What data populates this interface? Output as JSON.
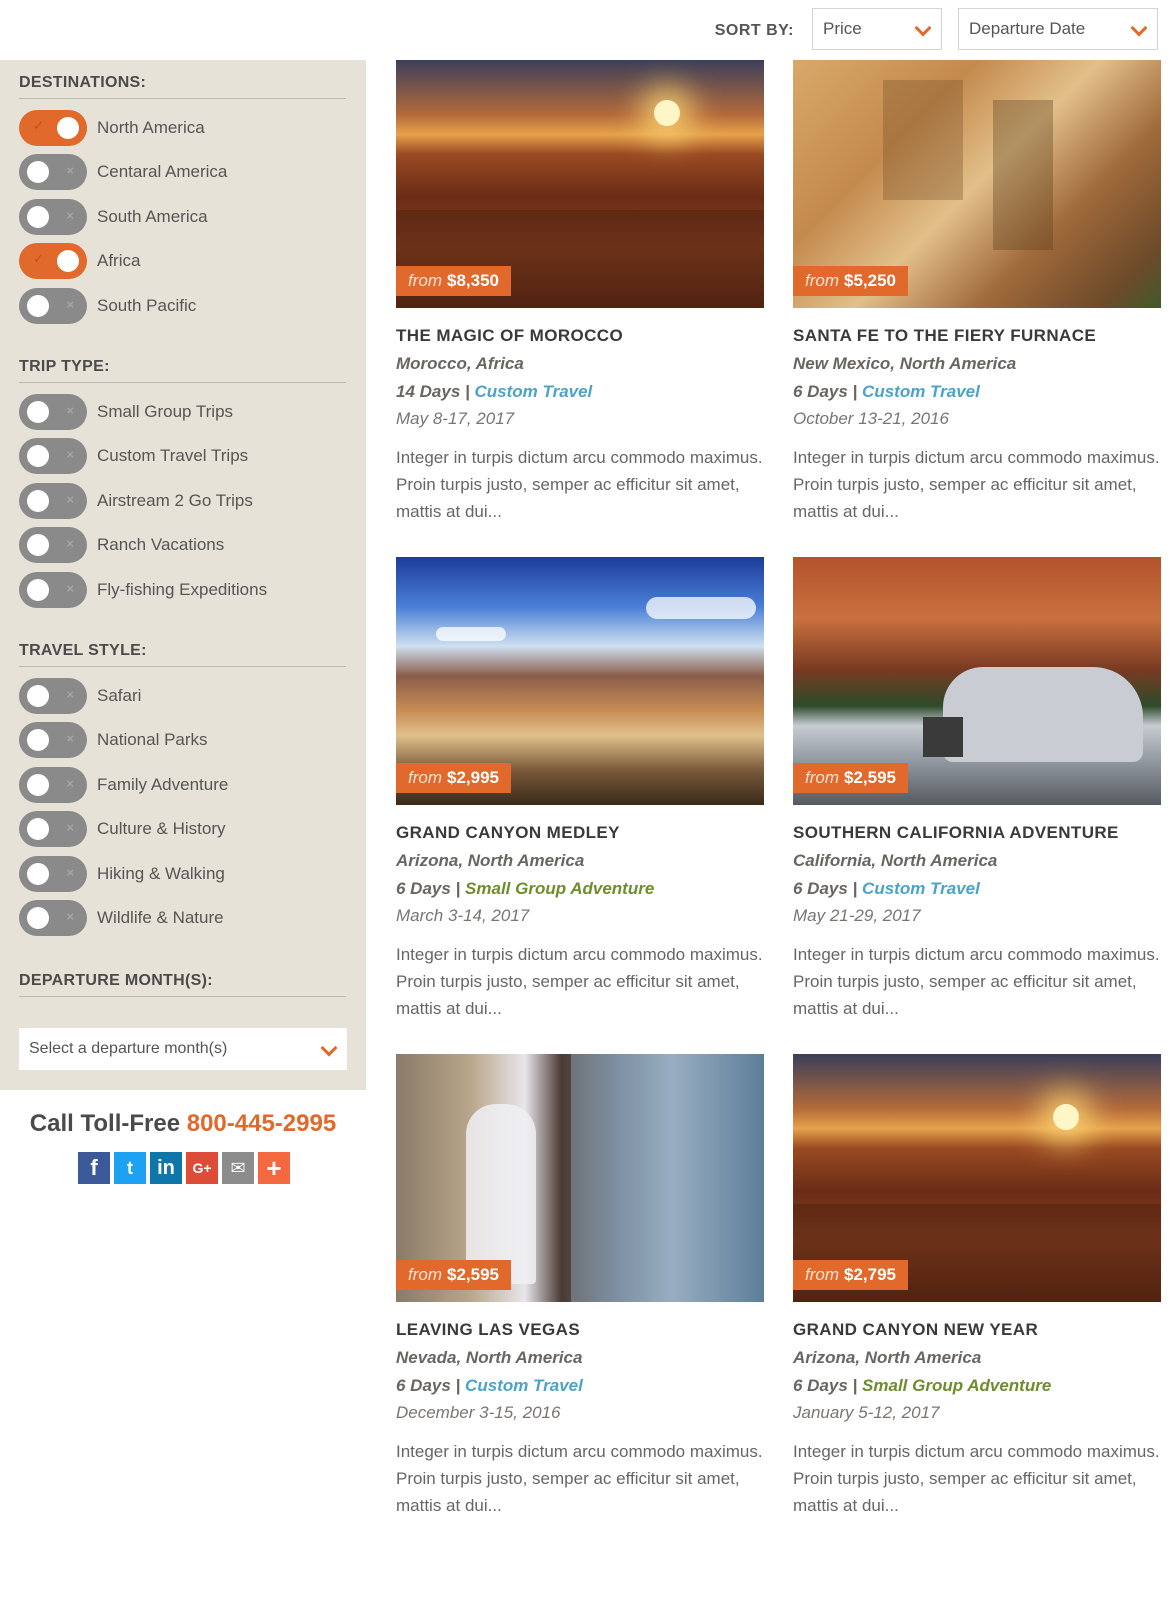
{
  "sort": {
    "label": "SORT BY:",
    "price_value": "Price",
    "date_value": "Departure Date"
  },
  "filters": {
    "destinations": {
      "heading": "DESTINATIONS:",
      "items": [
        {
          "label": "North America",
          "checked": true
        },
        {
          "label": "Centaral America",
          "checked": false
        },
        {
          "label": "South America",
          "checked": false
        },
        {
          "label": "Africa",
          "checked": true
        },
        {
          "label": "South Pacific",
          "checked": false
        }
      ]
    },
    "trip_type": {
      "heading": "TRIP TYPE:",
      "items": [
        {
          "label": "Small Group Trips",
          "checked": false
        },
        {
          "label": "Custom Travel Trips",
          "checked": false
        },
        {
          "label": "Airstream 2 Go Trips",
          "checked": false
        },
        {
          "label": "Ranch Vacations",
          "checked": false
        },
        {
          "label": "Fly-fishing Expeditions",
          "checked": false
        }
      ]
    },
    "travel_style": {
      "heading": "TRAVEL STYLE:",
      "items": [
        {
          "label": "Safari",
          "checked": false
        },
        {
          "label": "National Parks",
          "checked": false
        },
        {
          "label": "Family Adventure",
          "checked": false
        },
        {
          "label": "Culture & History",
          "checked": false
        },
        {
          "label": "Hiking & Walking",
          "checked": false
        },
        {
          "label": "Wildlife & Nature",
          "checked": false
        }
      ]
    },
    "departure": {
      "heading": "DEPARTURE MONTH(S):",
      "placeholder": "Select a departure month(s)"
    }
  },
  "contact": {
    "call_label": "Call Toll-Free",
    "phone": "800-445-2995"
  },
  "social": {
    "facebook": "f",
    "twitter": "t",
    "linkedin": "in",
    "google": "G+",
    "email": "✉",
    "share": "+"
  },
  "toggle_marks": {
    "on": "✓",
    "off": "×"
  },
  "price_from": "from",
  "trips": [
    {
      "price": "$8,350",
      "title": "THE MAGIC OF MOROCCO",
      "location": "Morocco, Africa",
      "days": "14 Days |",
      "type": "Custom Travel",
      "dates": "May 8-17, 2017",
      "description": "Integer in turpis dictum arcu commodo maximus. Proin turpis justo, semper ac efficitur sit amet, mattis at dui..."
    },
    {
      "price": "$5,250",
      "title": "SANTA FE TO THE FIERY FURNACE",
      "location": "New Mexico, North America",
      "days": "6 Days |",
      "type": "Custom Travel",
      "dates": "October 13-21, 2016",
      "description": "Integer in turpis dictum arcu commodo maximus. Proin turpis justo, semper ac efficitur sit amet, mattis at dui..."
    },
    {
      "price": "$2,995",
      "title": "GRAND CANYON MEDLEY",
      "location": "Arizona, North America",
      "days": "6 Days |",
      "type": "Small Group Adventure",
      "dates": "March 3-14, 2017",
      "description": "Integer in turpis dictum arcu commodo maximus. Proin turpis justo, semper ac efficitur sit amet, mattis at dui..."
    },
    {
      "price": "$2,595",
      "title": "SOUTHERN CALIFORNIA ADVENTURE",
      "location": "California, North America",
      "days": "6 Days |",
      "type": "Custom Travel",
      "dates": "May 21-29, 2017",
      "description": "Integer in turpis dictum arcu commodo maximus. Proin turpis justo, semper ac efficitur sit amet, mattis at dui..."
    },
    {
      "price": "$2,595",
      "title": "LEAVING LAS VEGAS",
      "location": "Nevada, North America",
      "days": "6 Days |",
      "type": "Custom Travel",
      "dates": "December 3-15, 2016",
      "description": "Integer in turpis dictum arcu commodo maximus. Proin turpis justo, semper ac efficitur sit amet, mattis at dui..."
    },
    {
      "price": "$2,795",
      "title": "GRAND CANYON NEW YEAR",
      "location": "Arizona, North America",
      "days": "6 Days |",
      "type": "Small Group Adventure",
      "dates": "January 5-12, 2017",
      "description": "Integer in turpis dictum arcu commodo maximus. Proin turpis justo, semper ac efficitur sit amet, mattis at dui..."
    }
  ],
  "colors": {
    "accent": "#e0692b",
    "custom_travel": "#4aa3c9",
    "small_group": "#6e8d2c",
    "sidebar_bg": "#e6e2d7"
  }
}
